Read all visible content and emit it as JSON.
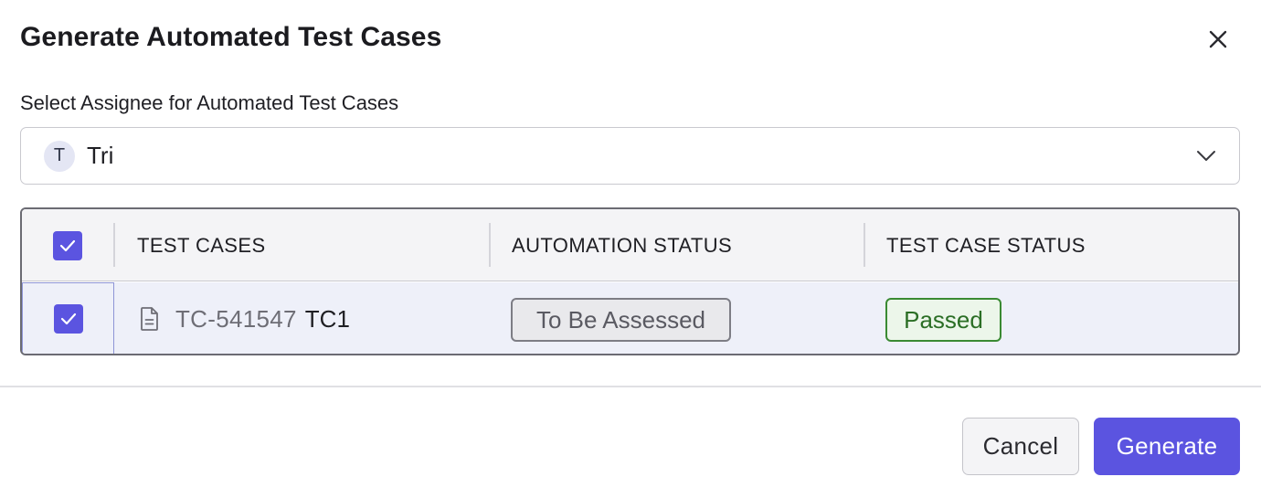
{
  "dialog": {
    "title": "Generate Automated Test Cases"
  },
  "assignee": {
    "label": "Select Assignee for Automated Test Cases",
    "avatar_initial": "T",
    "selected": "Tri"
  },
  "table": {
    "headers": {
      "test_cases": "TEST CASES",
      "automation_status": "AUTOMATION STATUS",
      "test_case_status": "TEST CASE STATUS"
    },
    "rows": [
      {
        "key": "TC-541547",
        "name": "TC1",
        "automation_status": "To Be Assessed",
        "test_case_status": "Passed",
        "checked": true
      }
    ],
    "select_all_checked": true
  },
  "footer": {
    "cancel_label": "Cancel",
    "generate_label": "Generate"
  },
  "colors": {
    "accent": "#5b54e0",
    "passed": "#2b6e25",
    "neutral_badge": "#5a5a62"
  },
  "icons": {
    "close": "close-icon",
    "dropdown": "chevron-down-icon",
    "document": "document-icon",
    "check": "checkmark-icon"
  }
}
